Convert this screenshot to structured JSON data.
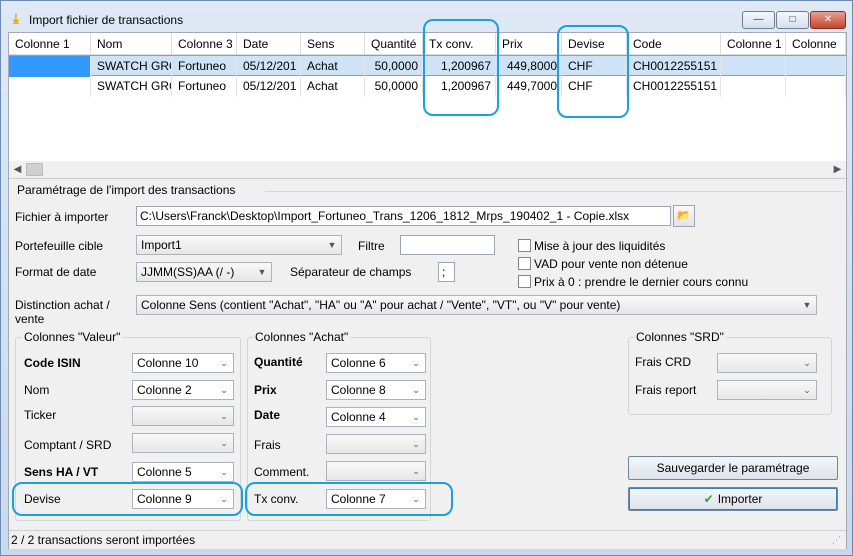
{
  "window": {
    "title": "Import fichier de transactions",
    "buttons": {
      "minimize": "—",
      "maximize": "□",
      "close": "✕"
    }
  },
  "grid": {
    "headers": [
      "Colonne 1",
      "Nom",
      "Colonne 3",
      "Date",
      "Sens",
      "Quantité",
      "Tx conv.",
      "Prix",
      "Devise",
      "Code",
      "Colonne 1",
      "Colonne"
    ],
    "rows": [
      [
        "",
        "SWATCH GRO",
        "Fortuneo",
        "05/12/201",
        "Achat",
        "50,0000",
        "1,200967",
        "449,8000",
        "CHF",
        "CH0012255151",
        "",
        ""
      ],
      [
        "",
        "SWATCH GRO",
        "Fortuneo",
        "05/12/201",
        "Achat",
        "50,0000",
        "1,200967",
        "449,7000",
        "CHF",
        "CH0012255151",
        "",
        ""
      ]
    ]
  },
  "settings_title": "Paramétrage de l'import des transactions",
  "form": {
    "file_label": "Fichier à importer",
    "file_value": "C:\\Users\\Franck\\Desktop\\Import_Fortuneo_Trans_1206_1812_Mrps_190402_1 - Copie.xlsx",
    "portfolio_label": "Portefeuille cible",
    "portfolio_value": "Import1",
    "filter_label": "Filtre",
    "filter_value": "",
    "date_format_label": "Format de date",
    "date_format_value": "JJMM(SS)AA (/ -)",
    "separator_label": "Séparateur de champs",
    "separator_value": ";",
    "check_liquidity": "Mise à jour des liquidités",
    "check_vad": "VAD pour vente non détenue",
    "check_price_zero": "Prix à 0 : prendre le dernier cours connu",
    "distinction_label_1": "Distinction achat /",
    "distinction_label_2": "vente",
    "distinction_value": "Colonne Sens (contient \"Achat\", \"HA\" ou \"A\" pour achat / \"Vente\", \"VT\", ou \"V\" pour vente)"
  },
  "valeur": {
    "title": "Colonnes \"Valeur\"",
    "items": [
      {
        "label": "Code ISIN",
        "value": "Colonne 10"
      },
      {
        "label": "Nom",
        "value": "Colonne 2"
      },
      {
        "label": "Ticker",
        "value": ""
      },
      {
        "label": "Comptant / SRD",
        "value": ""
      },
      {
        "label": "Sens HA / VT",
        "value": "Colonne 5"
      },
      {
        "label": "Devise",
        "value": "Colonne 9"
      }
    ]
  },
  "achat": {
    "title": "Colonnes \"Achat\"",
    "items": [
      {
        "label": "Quantité",
        "value": "Colonne 6"
      },
      {
        "label": "Prix",
        "value": "Colonne 8"
      },
      {
        "label": "Date",
        "value": "Colonne 4"
      },
      {
        "label": "Frais",
        "value": ""
      },
      {
        "label": "Comment.",
        "value": ""
      },
      {
        "label": "Tx conv.",
        "value": "Colonne 7"
      }
    ]
  },
  "srd": {
    "title": "Colonnes \"SRD\"",
    "items": [
      {
        "label": "Frais CRD",
        "value": ""
      },
      {
        "label": "Frais report",
        "value": ""
      }
    ]
  },
  "buttons": {
    "save": "Sauvegarder le paramétrage",
    "import": "Importer"
  },
  "status": "2 / 2 transactions seront importées",
  "colors": {
    "highlight": "#1aa0e0",
    "selection": "#3399ff"
  }
}
